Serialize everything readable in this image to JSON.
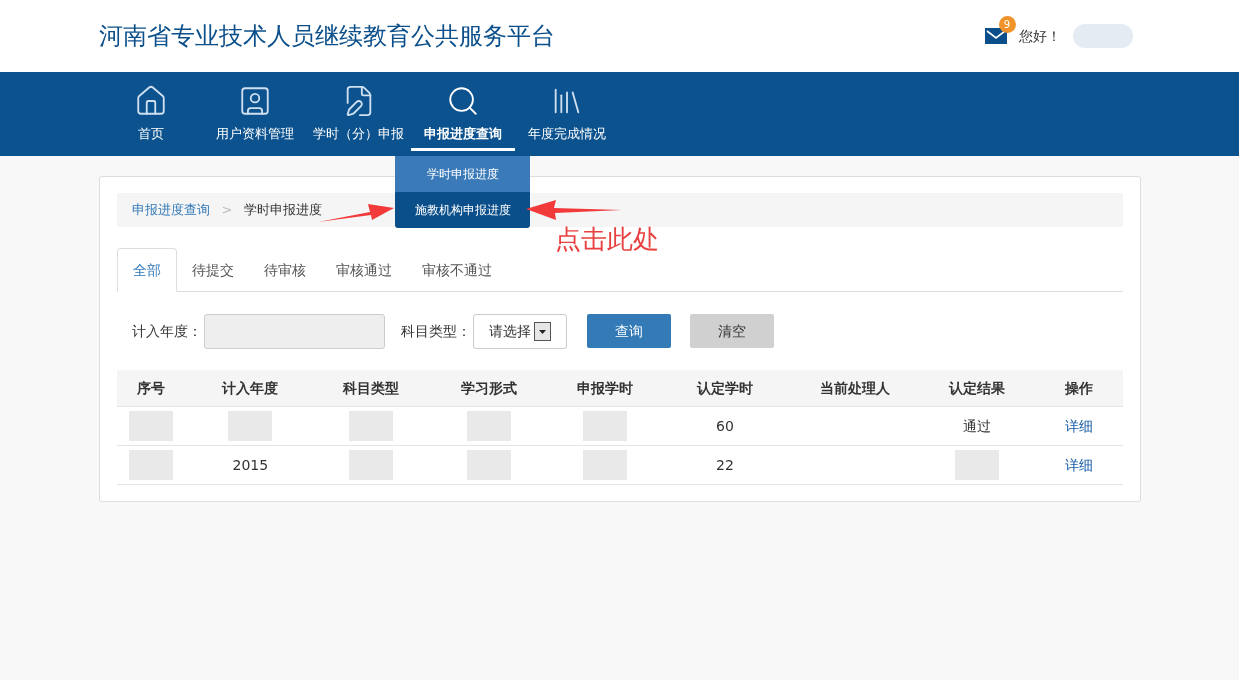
{
  "header": {
    "title": "河南省专业技术人员继续教育公共服务平台",
    "mail_badge": "9",
    "greeting": "您好！"
  },
  "nav": [
    {
      "label": "首页",
      "selected": false
    },
    {
      "label": "用户资料管理",
      "selected": false
    },
    {
      "label": "学时（分）申报",
      "selected": false
    },
    {
      "label": "申报进度查询",
      "selected": true
    },
    {
      "label": "年度完成情况",
      "selected": false
    }
  ],
  "dropdown": [
    {
      "label": "学时申报进度",
      "selected": false
    },
    {
      "label": "施教机构申报进度",
      "selected": true
    }
  ],
  "breadcrumb": {
    "items": [
      "申报进度查询",
      "学时申报进度"
    ],
    "separator": ">"
  },
  "annotation": {
    "text": "点击此处"
  },
  "tabs": [
    {
      "label": "全部",
      "selected": true
    },
    {
      "label": "待提交",
      "selected": false
    },
    {
      "label": "待审核",
      "selected": false
    },
    {
      "label": "审核通过",
      "selected": false
    },
    {
      "label": "审核不通过",
      "selected": false
    }
  ],
  "filters": {
    "year_label": "计入年度：",
    "subject_label": "科目类型：",
    "subject_value": "请选择",
    "query_button": "查询",
    "clear_button": "清空"
  },
  "table": {
    "columns": [
      "序号",
      "计入年度",
      "科目类型",
      "学习形式",
      "申报学时",
      "认定学时",
      "当前处理人",
      "认定结果",
      "操作"
    ],
    "rows": [
      {
        "cells": [
          {
            "kind": "blur"
          },
          {
            "kind": "blur"
          },
          {
            "kind": "blur"
          },
          {
            "kind": "blur"
          },
          {
            "kind": "blur"
          },
          {
            "kind": "text",
            "text": "60"
          },
          {
            "kind": "empty"
          },
          {
            "kind": "text",
            "text": "通过"
          },
          {
            "kind": "link",
            "text": "详细"
          }
        ]
      },
      {
        "cells": [
          {
            "kind": "blur"
          },
          {
            "kind": "text",
            "text": "2015"
          },
          {
            "kind": "blur"
          },
          {
            "kind": "blur"
          },
          {
            "kind": "blur"
          },
          {
            "kind": "text",
            "text": "22"
          },
          {
            "kind": "empty"
          },
          {
            "kind": "blur"
          },
          {
            "kind": "link",
            "text": "详细"
          }
        ]
      }
    ]
  }
}
